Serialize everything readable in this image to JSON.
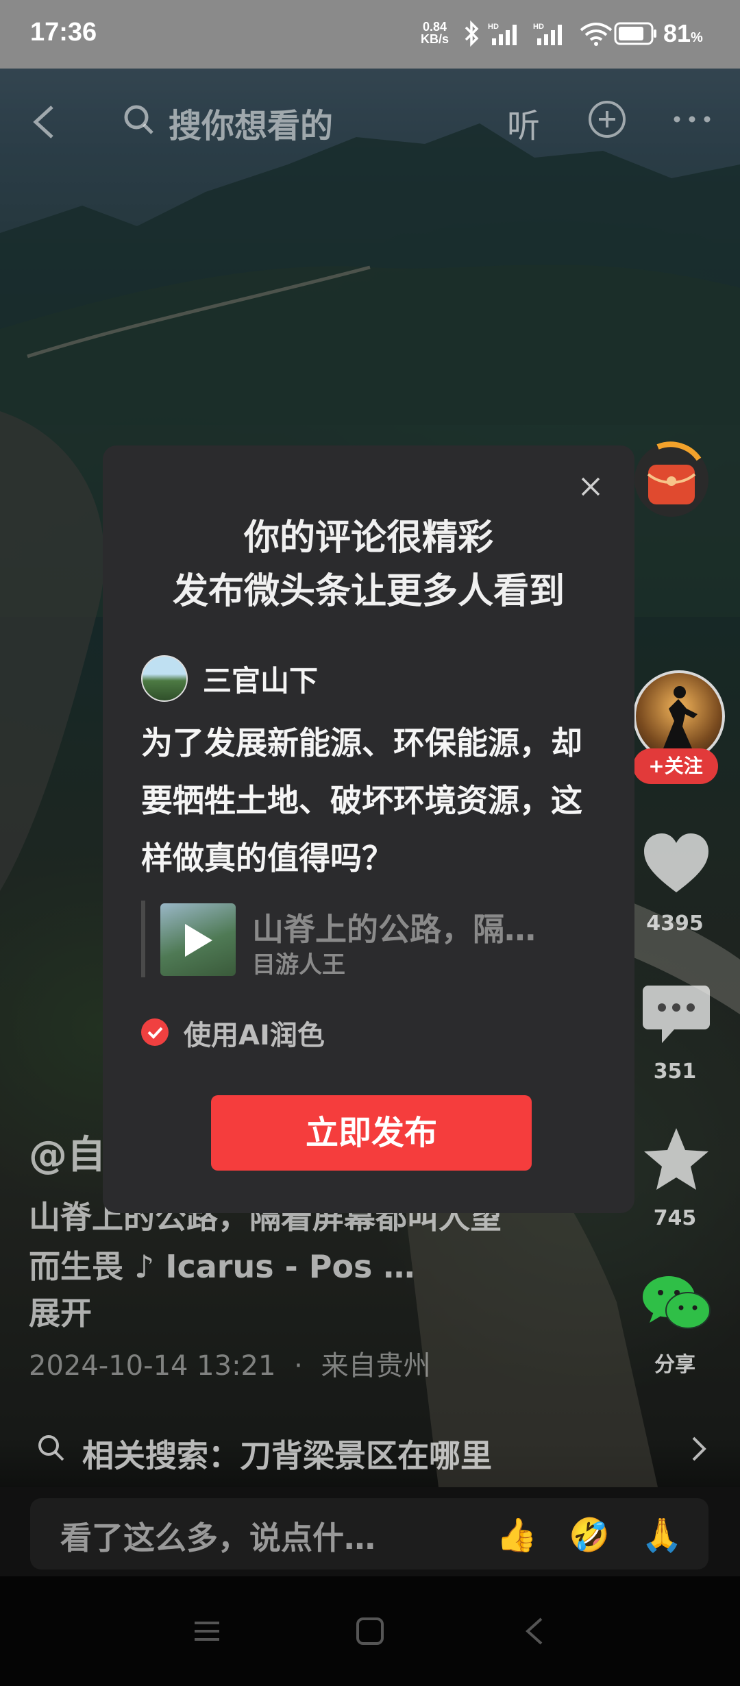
{
  "status_bar": {
    "time": "17:36",
    "net_speed_value": "0.84",
    "net_speed_unit": "KB/s",
    "battery_percent": "81",
    "battery_unit": "%",
    "battery_level": 0.81
  },
  "top_bar": {
    "search_placeholder": "搜你想看的",
    "listen_label": "听"
  },
  "modal": {
    "title_line1": "你的评论很精彩",
    "title_line2": "发布微头条让更多人看到",
    "username": "三官山下",
    "comment_text": "为了发展新能源、环保能源，却要牺牲土地、破坏环境资源，这样做真的值得吗？",
    "video_title": "山脊上的公路，隔…",
    "video_author": "目游人王",
    "ai_polish_label": "使用AI润色",
    "ai_polish_checked": true,
    "publish_button": "立即发布"
  },
  "right_rail": {
    "follow_label": "+关注",
    "likes": "4395",
    "comments": "351",
    "favorites": "745",
    "share_label": "分享"
  },
  "post": {
    "author": "@自",
    "description_line1": "山脊上的公路，隔着屏幕都叫人望",
    "description_line2": "而生畏 ♪ Icarus - Pos    …",
    "expand_label": "展开",
    "timestamp": "2024-10-14 13:21",
    "location": "来自贵州",
    "meta_separator": "·"
  },
  "related_search": {
    "text": "相关搜索：刀背梁景区在哪里"
  },
  "comment_bar": {
    "placeholder": "看了这么多，说点什…",
    "emojis": [
      "👍",
      "🤣",
      "🙏"
    ]
  },
  "colors": {
    "accent_red": "#f53d3d",
    "modal_bg": "#2b2b2d"
  }
}
